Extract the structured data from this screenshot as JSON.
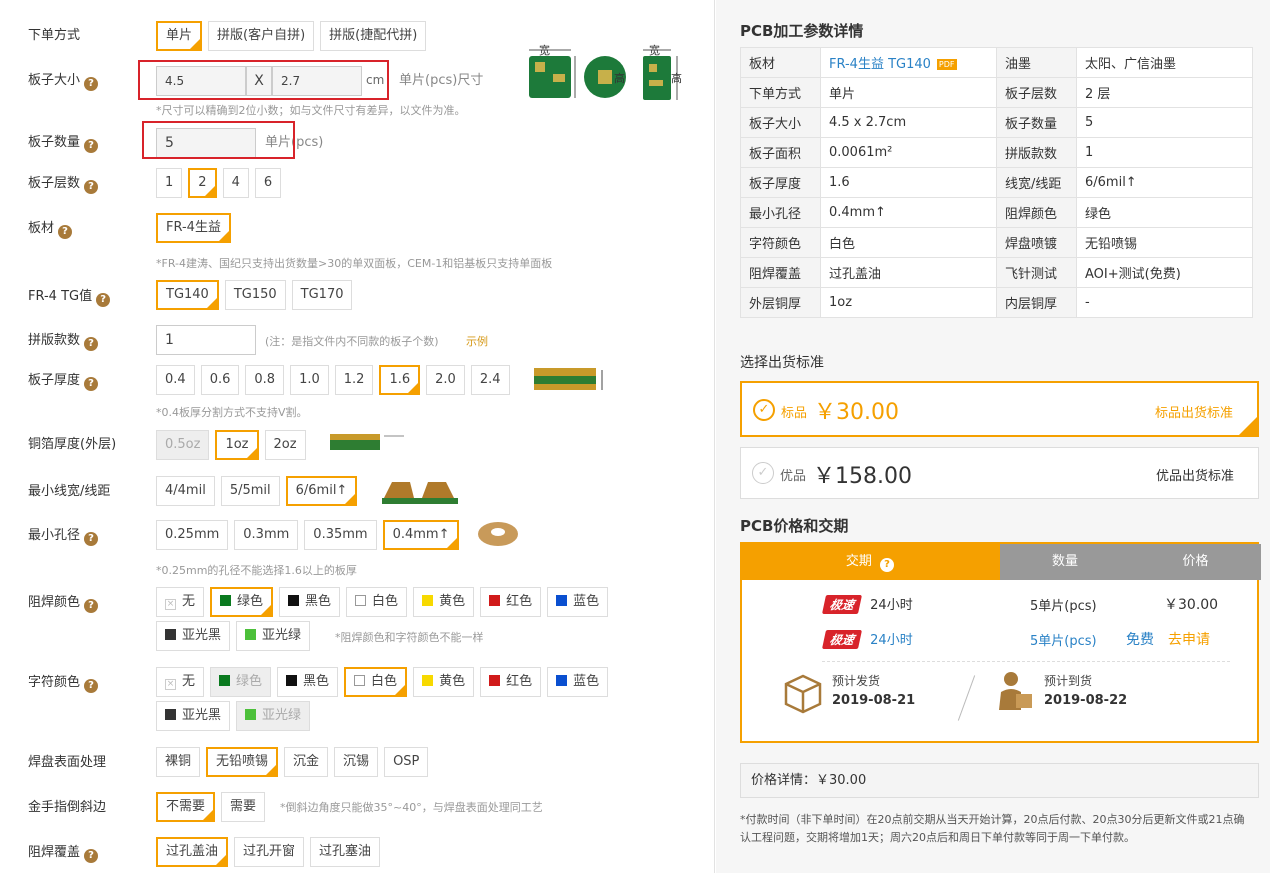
{
  "form": {
    "order_type": {
      "label": "下单方式",
      "options": [
        "单片",
        "拼版(客户自拼)",
        "拼版(捷配代拼)"
      ],
      "selected": 0
    },
    "size": {
      "label": "板子大小",
      "w": "4.5",
      "x": "X",
      "h": "2.7",
      "unit": "cm",
      "suffix": "单片(pcs)尺寸",
      "note": "*尺寸可以精确到2位小数；如与文件尺寸有差异，以文件为准。",
      "dim_w": "宽",
      "dim_h": "高"
    },
    "qty": {
      "label": "板子数量",
      "value": "5",
      "unit": "单片(pcs)"
    },
    "layers": {
      "label": "板子层数",
      "options": [
        "1",
        "2",
        "4",
        "6"
      ],
      "selected": 1
    },
    "material": {
      "label": "板材",
      "options": [
        "FR-4生益"
      ],
      "selected": 0,
      "note": "*FR-4建涛、国纪只支持出货数量>30的单双面板，CEM-1和铝基板只支持单面板"
    },
    "tg": {
      "label": "FR-4 TG值",
      "options": [
        "TG140",
        "TG150",
        "TG170"
      ],
      "selected": 0
    },
    "panel": {
      "label": "拼版款数",
      "value": "1",
      "note": "(注：是指文件内不同款的板子个数)",
      "link": "示例"
    },
    "thickness": {
      "label": "板子厚度",
      "options": [
        "0.4",
        "0.6",
        "0.8",
        "1.0",
        "1.2",
        "1.6",
        "2.0",
        "2.4"
      ],
      "selected": 5,
      "note": "*0.4板厚分割方式不支持V割。"
    },
    "copper": {
      "label": "铜箔厚度(外层)",
      "options": [
        "0.5oz",
        "1oz",
        "2oz"
      ],
      "selected": 1,
      "disabled": [
        0
      ]
    },
    "trace": {
      "label": "最小线宽/线距",
      "options": [
        "4/4mil",
        "5/5mil",
        "6/6mil↑"
      ],
      "selected": 2
    },
    "hole": {
      "label": "最小孔径",
      "options": [
        "0.25mm",
        "0.3mm",
        "0.35mm",
        "0.4mm↑"
      ],
      "selected": 3,
      "note": "*0.25mm的孔径不能选择1.6以上的板厚"
    },
    "mask": {
      "label": "阻焊颜色",
      "options": [
        "无",
        "绿色",
        "黑色",
        "白色",
        "黄色",
        "红色",
        "蓝色",
        "亚光黑",
        "亚光绿"
      ],
      "selected": 1,
      "note": "*阻焊颜色和字符颜色不能一样"
    },
    "silk": {
      "label": "字符颜色",
      "options": [
        "无",
        "绿色",
        "黑色",
        "白色",
        "黄色",
        "红色",
        "蓝色",
        "亚光黑",
        "亚光绿"
      ],
      "selected": 3,
      "disabled": [
        1,
        8
      ]
    },
    "finish": {
      "label": "焊盘表面处理",
      "options": [
        "裸铜",
        "无铅喷锡",
        "沉金",
        "沉锡",
        "OSP"
      ],
      "selected": 1
    },
    "bevel": {
      "label": "金手指倒斜边",
      "options": [
        "不需要",
        "需要"
      ],
      "selected": 0,
      "note": "*倒斜边角度只能做35°~40°，与焊盘表面处理同工艺"
    },
    "via": {
      "label": "阻焊覆盖",
      "options": [
        "过孔盖油",
        "过孔开窗",
        "过孔塞油"
      ],
      "selected": 0
    }
  },
  "colors": {
    "无": "#ffffff",
    "绿色": "#0a7a1f",
    "黑色": "#111111",
    "白色": "#ffffff",
    "黄色": "#f7d900",
    "红色": "#d11a1a",
    "蓝色": "#0a4fd0",
    "亚光黑": "#333333",
    "亚光绿": "#4cc03a",
    "accent": "#f5a000",
    "red": "#d8232a"
  },
  "summary": {
    "title": "PCB加工参数详情",
    "rows": [
      [
        "板材",
        "FR-4生益 TG140",
        "油墨",
        "太阳、广信油墨"
      ],
      [
        "下单方式",
        "单片",
        "板子层数",
        "2 层"
      ],
      [
        "板子大小",
        "4.5 x 2.7cm",
        "板子数量",
        "5"
      ],
      [
        "板子面积",
        "0.0061m²",
        "拼版款数",
        "1"
      ],
      [
        "板子厚度",
        "1.6",
        "线宽/线距",
        "6/6mil↑"
      ],
      [
        "最小孔径",
        "0.4mm↑",
        "阻焊颜色",
        "绿色"
      ],
      [
        "字符颜色",
        "白色",
        "焊盘喷镀",
        "无铅喷锡"
      ],
      [
        "阻焊覆盖",
        "过孔盖油",
        "飞针测试",
        "AOI+测试(免费)"
      ],
      [
        "外层铜厚",
        "1oz",
        "内层铜厚",
        "-"
      ]
    ],
    "pdf": "PDF"
  },
  "standard": {
    "title": "选择出货标准",
    "items": [
      {
        "name": "标品",
        "price": "￥30.00",
        "link": "标品出货标准"
      },
      {
        "name": "优品",
        "price": "￥158.00",
        "link": "优品出货标准"
      }
    ]
  },
  "price": {
    "title": "PCB价格和交期",
    "headers": [
      "交期",
      "数量",
      "价格"
    ],
    "rows": [
      {
        "badge": "极速",
        "time": "24小时",
        "qty": "5单片(pcs)",
        "price": "￥30.00"
      },
      {
        "badge": "极速",
        "time": "24小时",
        "qty": "5单片(pcs)",
        "price": "免费",
        "apply": "去申请"
      }
    ],
    "ship_label": "预计发货",
    "ship_date": "2019-08-21",
    "arrive_label": "预计到货",
    "arrive_date": "2019-08-22"
  },
  "detail": "价格详情：￥30.00",
  "footnote": "*付款时间（非下单时间）在20点前交期从当天开始计算，20点后付款、20点30分后更新文件或21点确认工程问题，交期将增加1天；周六20点后和周日下单付款等同于周一下单付款。"
}
